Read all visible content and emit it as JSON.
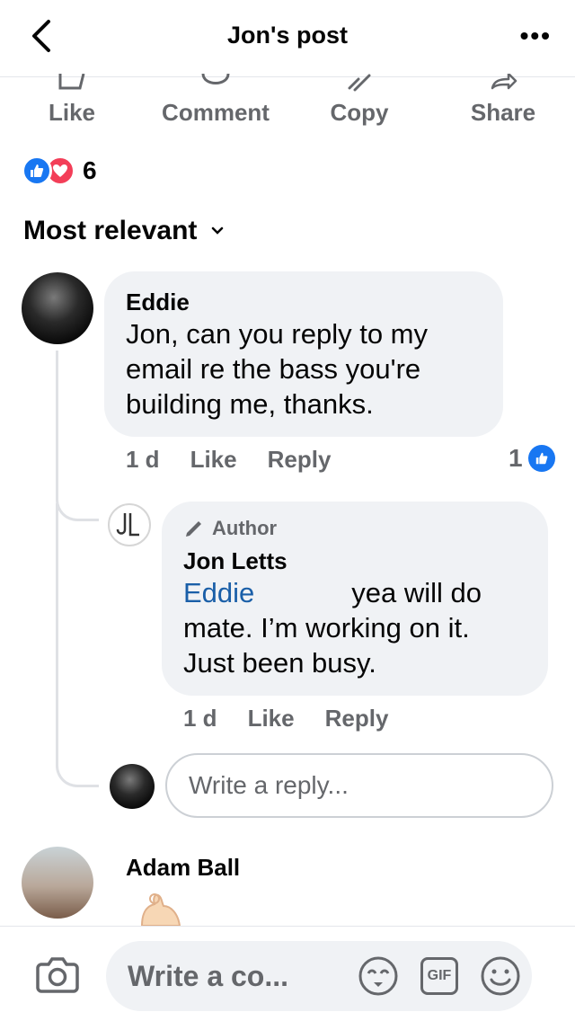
{
  "header": {
    "title": "Jon's post",
    "back_icon": "chevron-left-icon",
    "more_icon": "ellipsis-icon"
  },
  "actions": [
    {
      "label": "Like",
      "icon": "thumbs-up-icon"
    },
    {
      "label": "Comment",
      "icon": "comment-icon"
    },
    {
      "label": "Copy",
      "icon": "link-icon"
    },
    {
      "label": "Share",
      "icon": "share-icon"
    }
  ],
  "reactions": {
    "count": "6",
    "types": [
      "like",
      "love"
    ]
  },
  "sort": {
    "label": "Most relevant"
  },
  "comments": [
    {
      "author": "Eddie",
      "text": "Jon, can you reply to my email re the bass you're building me, thanks.",
      "time": "1 d",
      "like_label": "Like",
      "reply_label": "Reply",
      "like_count": "1",
      "replies": [
        {
          "badge": "Author",
          "author": "Jon Letts",
          "mention": "Eddie",
          "text": "yea will do mate. I’m working on it. Just been busy.",
          "time": "1 d",
          "like_label": "Like",
          "reply_label": "Reply"
        }
      ],
      "reply_placeholder": "Write a reply..."
    },
    {
      "author": "Adam Ball"
    }
  ],
  "composer": {
    "placeholder": "Write a co...",
    "icons": [
      "camera-icon",
      "avatar-sticker-icon",
      "gif-icon",
      "emoji-icon"
    ],
    "gif_label": "GIF"
  },
  "colors": {
    "accent": "#1877f2",
    "love": "#f33e58",
    "mention": "#1a5fa8",
    "muted": "#65676b",
    "bubble": "#f0f2f5"
  }
}
